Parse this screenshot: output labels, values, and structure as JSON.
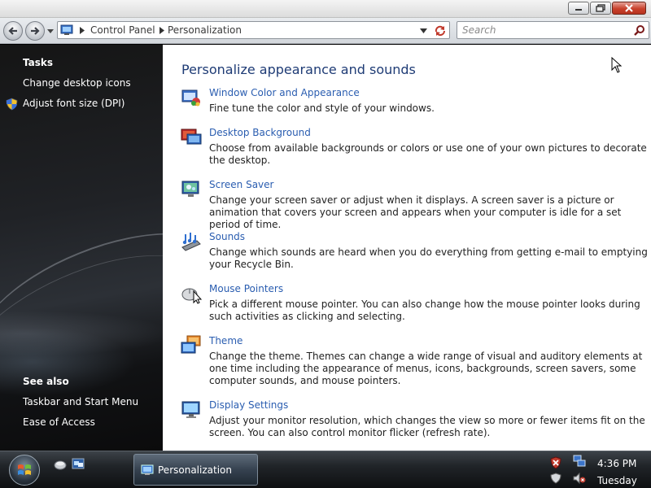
{
  "window": {
    "buttons": [
      "minimize",
      "maximize",
      "close"
    ]
  },
  "nav": {
    "breadcrumbs": [
      "Control Panel",
      "Personalization"
    ],
    "search_placeholder": "Search"
  },
  "sidebar": {
    "tasks_heading": "Tasks",
    "tasks": [
      {
        "label": "Change desktop icons"
      },
      {
        "label": "Adjust font size (DPI)",
        "icon": "shield-icon"
      }
    ],
    "see_also_heading": "See also",
    "see_also": [
      {
        "label": "Taskbar and Start Menu"
      },
      {
        "label": "Ease of Access"
      }
    ]
  },
  "main": {
    "title": "Personalize appearance and sounds",
    "items": [
      {
        "link": "Window Color and Appearance",
        "desc": "Fine tune the color and style of your windows.",
        "icon": "window-color-icon"
      },
      {
        "link": "Desktop Background",
        "desc": "Choose from available backgrounds or colors or use one of your own pictures to decorate the desktop.",
        "icon": "desktop-background-icon"
      },
      {
        "link": "Screen Saver",
        "desc": "Change your screen saver or adjust when it displays. A screen saver is a picture or animation that covers your screen and appears when your computer is idle for a set period of time.",
        "icon": "screen-saver-icon"
      },
      {
        "link": "Sounds",
        "desc": "Change which sounds are heard when you do everything from getting e-mail to emptying your Recycle Bin.",
        "icon": "sounds-icon"
      },
      {
        "link": "Mouse Pointers",
        "desc": "Pick a different mouse pointer. You can also change how the mouse pointer looks during such activities as clicking and selecting.",
        "icon": "mouse-pointers-icon"
      },
      {
        "link": "Theme",
        "desc": "Change the theme. Themes can change a wide range of visual and auditory elements at one time including the appearance of menus, icons, backgrounds, screen savers, some computer sounds, and mouse pointers.",
        "icon": "theme-icon"
      },
      {
        "link": "Display Settings",
        "desc": "Adjust your monitor resolution, which changes the view so more or fewer items fit on the screen. You can also control monitor flicker (refresh rate).",
        "icon": "display-settings-icon"
      }
    ]
  },
  "taskbar": {
    "active_window": "Personalization",
    "clock_time": "4:36 PM",
    "clock_day": "Tuesday"
  },
  "colors": {
    "link": "#2a5db0",
    "title": "#1e3b75",
    "sidebar_text": "#ffffff"
  }
}
